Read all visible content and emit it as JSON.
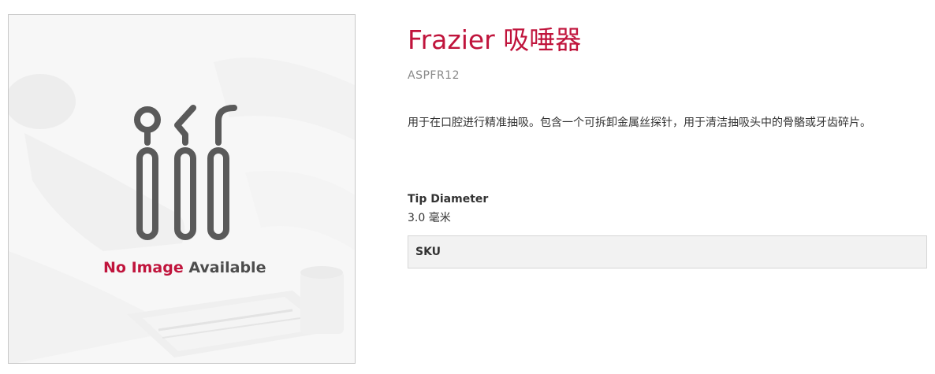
{
  "image": {
    "no_image_part1": "No Image",
    "no_image_part2": "Available",
    "accent_color": "#c0143c",
    "icon": "dental-tools-icon"
  },
  "product": {
    "title": "Frazier 吸唾器",
    "code": "ASPFR12",
    "description": "用于在口腔进行精准抽吸。包含一个可拆卸金属丝探针，用于清洁抽吸头中的骨骼或牙齿碎片。",
    "attribute_label": "Tip Diameter",
    "attribute_value": "3.0 毫米",
    "sku_label": "SKU"
  }
}
